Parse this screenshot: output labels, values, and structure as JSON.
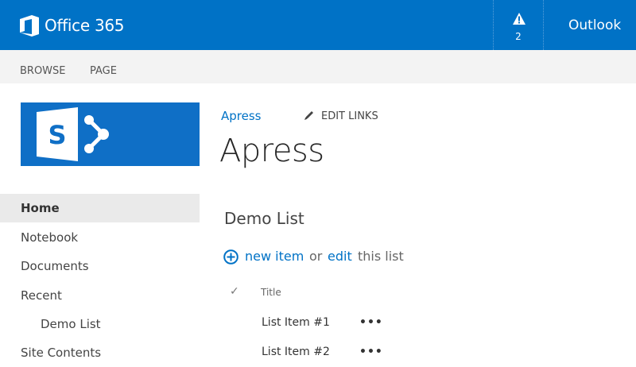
{
  "suite_bar": {
    "brand": "Office 365",
    "alerts_count": "2",
    "outlook_label": "Outlook",
    "background": "#0072c6"
  },
  "ribbon": {
    "tabs": [
      "BROWSE",
      "PAGE"
    ]
  },
  "site_logo": {
    "icon": "sharepoint-logo",
    "letter": "S",
    "background": "#0f6fc6"
  },
  "header": {
    "breadcrumb": "Apress",
    "edit_links": "EDIT LINKS",
    "title": "Apress"
  },
  "quick_launch": {
    "items": [
      {
        "label": "Home",
        "selected": true
      },
      {
        "label": "Notebook"
      },
      {
        "label": "Documents"
      },
      {
        "label": "Recent"
      },
      {
        "label": "Demo List",
        "child": true
      },
      {
        "label": "Site Contents"
      }
    ]
  },
  "webpart": {
    "title": "Demo List",
    "toolbar": {
      "new_item": "new item",
      "or": "or",
      "edit": "edit",
      "this_list": "this list"
    },
    "columns": {
      "check": "✓",
      "title": "Title"
    },
    "rows": [
      {
        "title": "List Item #1",
        "actions": "•••"
      },
      {
        "title": "List Item #2",
        "actions": "•••"
      }
    ]
  },
  "colors": {
    "link": "#0072c6",
    "ribbon": "#f3f3f3",
    "selected_nav": "#eaeaea"
  }
}
